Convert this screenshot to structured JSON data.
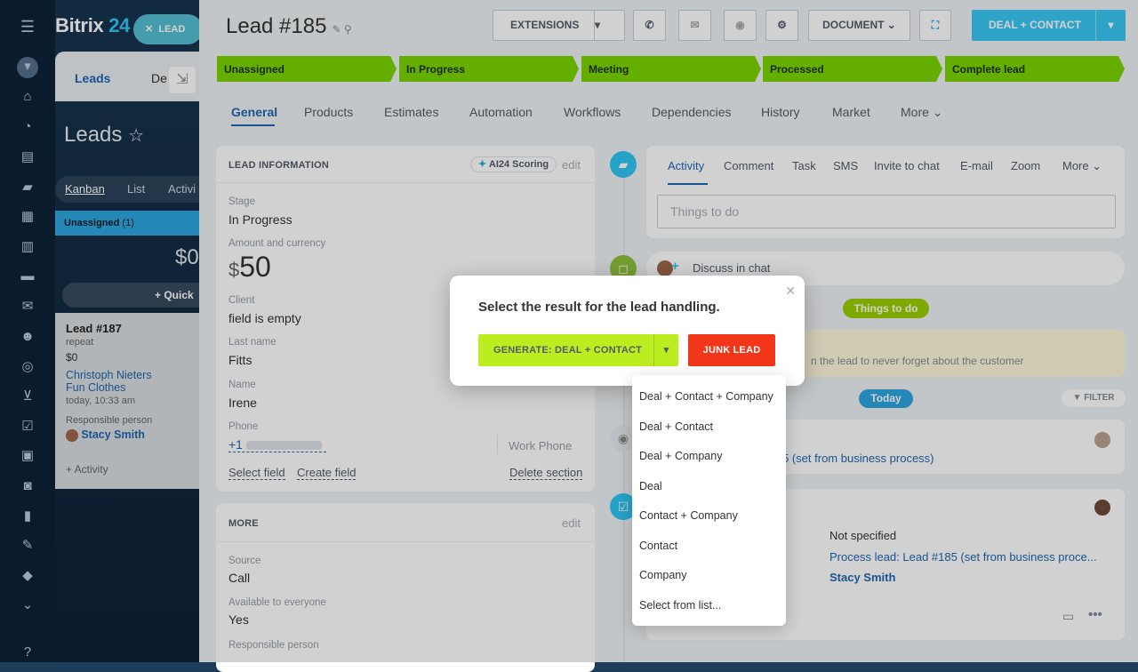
{
  "brand": {
    "name": "Bitrix",
    "num": "24"
  },
  "close_lead_label": "LEAD",
  "kanban": {
    "tabs": [
      "Leads",
      "De"
    ],
    "title": "Leads",
    "views": [
      "Kanban",
      "List",
      "Activi"
    ],
    "column": {
      "name": "Unassigned",
      "count": "(1)",
      "sum": "$0",
      "quick": "+ Quick"
    },
    "card": {
      "title": "Lead #187",
      "sub": "repeat",
      "amount": "$0",
      "contact": "Christoph Nieters",
      "company": "Fun Clothes",
      "time": "today, 10:33 am",
      "resp_label": "Responsible person",
      "resp_name": "Stacy Smith",
      "activity": "+ Activity"
    }
  },
  "header": {
    "title": "Lead #185",
    "extensions": "EXTENSIONS",
    "document": "DOCUMENT",
    "deal_contact": "DEAL + CONTACT"
  },
  "stages": [
    "Unassigned",
    "In Progress",
    "Meeting",
    "Processed",
    "Complete lead"
  ],
  "tabs": [
    "General",
    "Products",
    "Estimates",
    "Automation",
    "Workflows",
    "Dependencies",
    "History",
    "Market",
    "More"
  ],
  "lead_info": {
    "heading": "LEAD INFORMATION",
    "ai_scoring": "AI24 Scoring",
    "edit": "edit",
    "stage_label": "Stage",
    "stage_value": "In Progress",
    "amount_label": "Amount and currency",
    "amount_currency": "$",
    "amount_value": "50",
    "client_label": "Client",
    "client_value": "field is empty",
    "lastname_label": "Last name",
    "lastname_value": "Fitts",
    "name_label": "Name",
    "name_value": "Irene",
    "phone_label": "Phone",
    "phone_value": "+1",
    "phone_type": "Work Phone",
    "select_field": "Select field",
    "create_field": "Create field",
    "delete_section": "Delete section"
  },
  "more_info": {
    "heading": "MORE",
    "edit": "edit",
    "source_label": "Source",
    "source_value": "Call",
    "avail_label": "Available to everyone",
    "avail_value": "Yes",
    "resp_label": "Responsible person"
  },
  "activity": {
    "tabs": [
      "Activity",
      "Comment",
      "Task",
      "SMS",
      "Invite to chat",
      "E-mail",
      "Zoom",
      "More"
    ],
    "placeholder": "Things to do",
    "discuss": "Discuss in chat",
    "things_badge": "Things to do",
    "reminder": "n the lead to never forget about the customer",
    "today": "Today",
    "filter": "FILTER",
    "item1_link": "5 (set from business process)",
    "item2_status": "Not specified",
    "item2_link": "Process lead: Lead #185 (set from business proce...",
    "item2_person": "Stacy Smith"
  },
  "popup": {
    "title": "Select the result for the lead handling.",
    "generate": "GENERATE: DEAL + CONTACT",
    "junk": "JUNK LEAD",
    "menu": [
      "Deal + Contact + Company",
      "Deal + Contact",
      "Deal + Company",
      "Deal",
      "Contact + Company",
      "Contact",
      "Company",
      "Select from list..."
    ]
  },
  "colors": {
    "stage": "#7bd500",
    "generate": "#bbed21",
    "junk": "#f1361a",
    "accent": "#3bc8f5",
    "link": "#2067b0"
  },
  "icons": [
    "menu-icon",
    "funnel-icon",
    "home-icon",
    "chart-icon",
    "feed-icon",
    "chat-icon",
    "calendar-icon",
    "doc-icon",
    "drive-icon",
    "mail-icon",
    "people-icon",
    "target-icon",
    "cart-icon",
    "tasks-icon",
    "contact-icon",
    "robot-icon",
    "video-icon",
    "sign-icon",
    "box-icon",
    "more-icon",
    "help-icon"
  ]
}
